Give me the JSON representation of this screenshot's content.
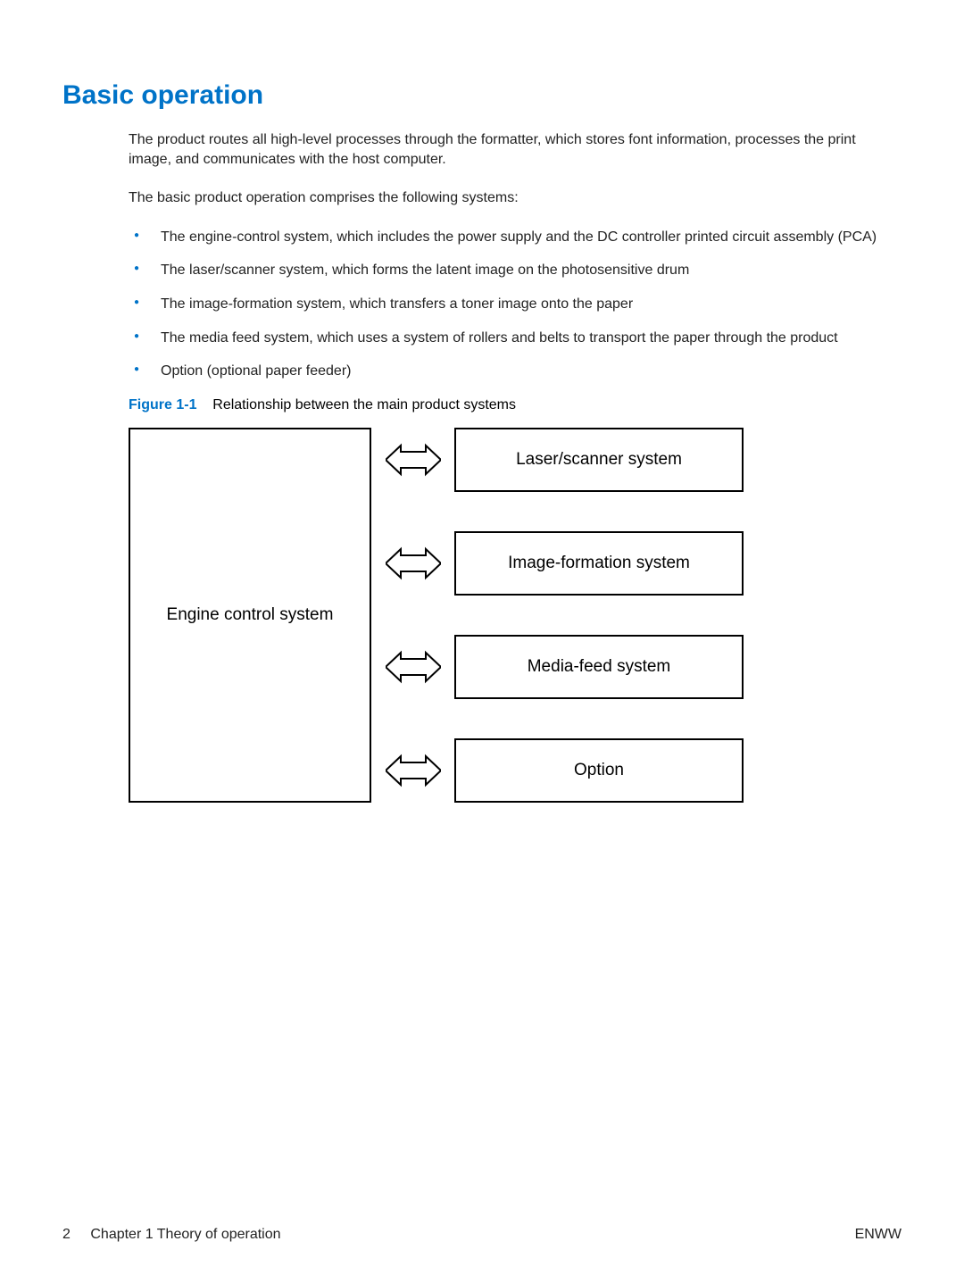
{
  "heading": "Basic operation",
  "para1": "The product routes all high-level processes through the formatter, which stores font information, processes the print image, and communicates with the host computer.",
  "para2": "The basic product operation comprises the following systems:",
  "bullets": [
    "The engine-control system, which includes the power supply and the DC controller printed circuit assembly (PCA)",
    "The laser/scanner system, which forms the latent image on the photosensitive drum",
    "The image-formation system, which transfers a toner image onto the paper",
    "The media feed system, which uses a system of rollers and belts to transport the paper through the product",
    "Option (optional paper feeder)"
  ],
  "figure": {
    "label": "Figure 1-1",
    "caption": "Relationship between the main product systems"
  },
  "diagram": {
    "engine": "Engine control system",
    "boxes": [
      "Laser/scanner system",
      "Image-formation system",
      "Media-feed system",
      "Option"
    ]
  },
  "footer": {
    "page_num": "2",
    "chapter": "Chapter 1   Theory of operation",
    "right": "ENWW"
  }
}
